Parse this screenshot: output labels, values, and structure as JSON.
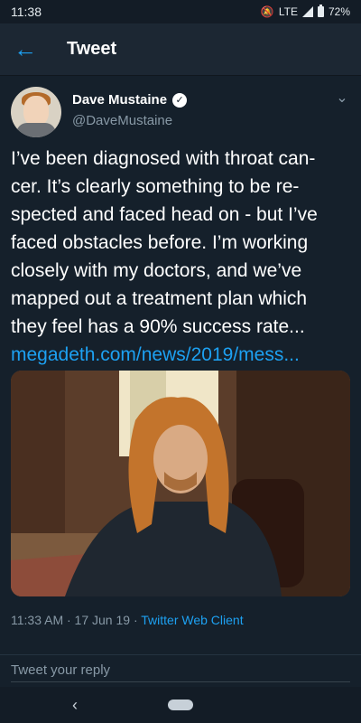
{
  "status": {
    "time": "11:38",
    "network": "LTE",
    "battery": "72%"
  },
  "header": {
    "title": "Tweet"
  },
  "author": {
    "name": "Dave Mustaine",
    "handle": "@DaveMustaine"
  },
  "tweet": {
    "lines": [
      "I’ve been diagnosed with throat can-",
      "cer. It’s clearly something to be re-",
      "spected and faced head on - but I’ve",
      "faced obstacles before. I’m working",
      "closely with my doctors, and we’ve",
      "mapped out a treatment plan which",
      "they feel has a 90% success rate..."
    ],
    "link": "megadeth.com/news/2019/mess..."
  },
  "meta": {
    "time_date": "11:33 AM · 17 Jun 19 · ",
    "client": "Twitter Web Client"
  },
  "reply": {
    "placeholder": "Tweet your reply"
  },
  "nav": {
    "back_icon": "‹"
  }
}
